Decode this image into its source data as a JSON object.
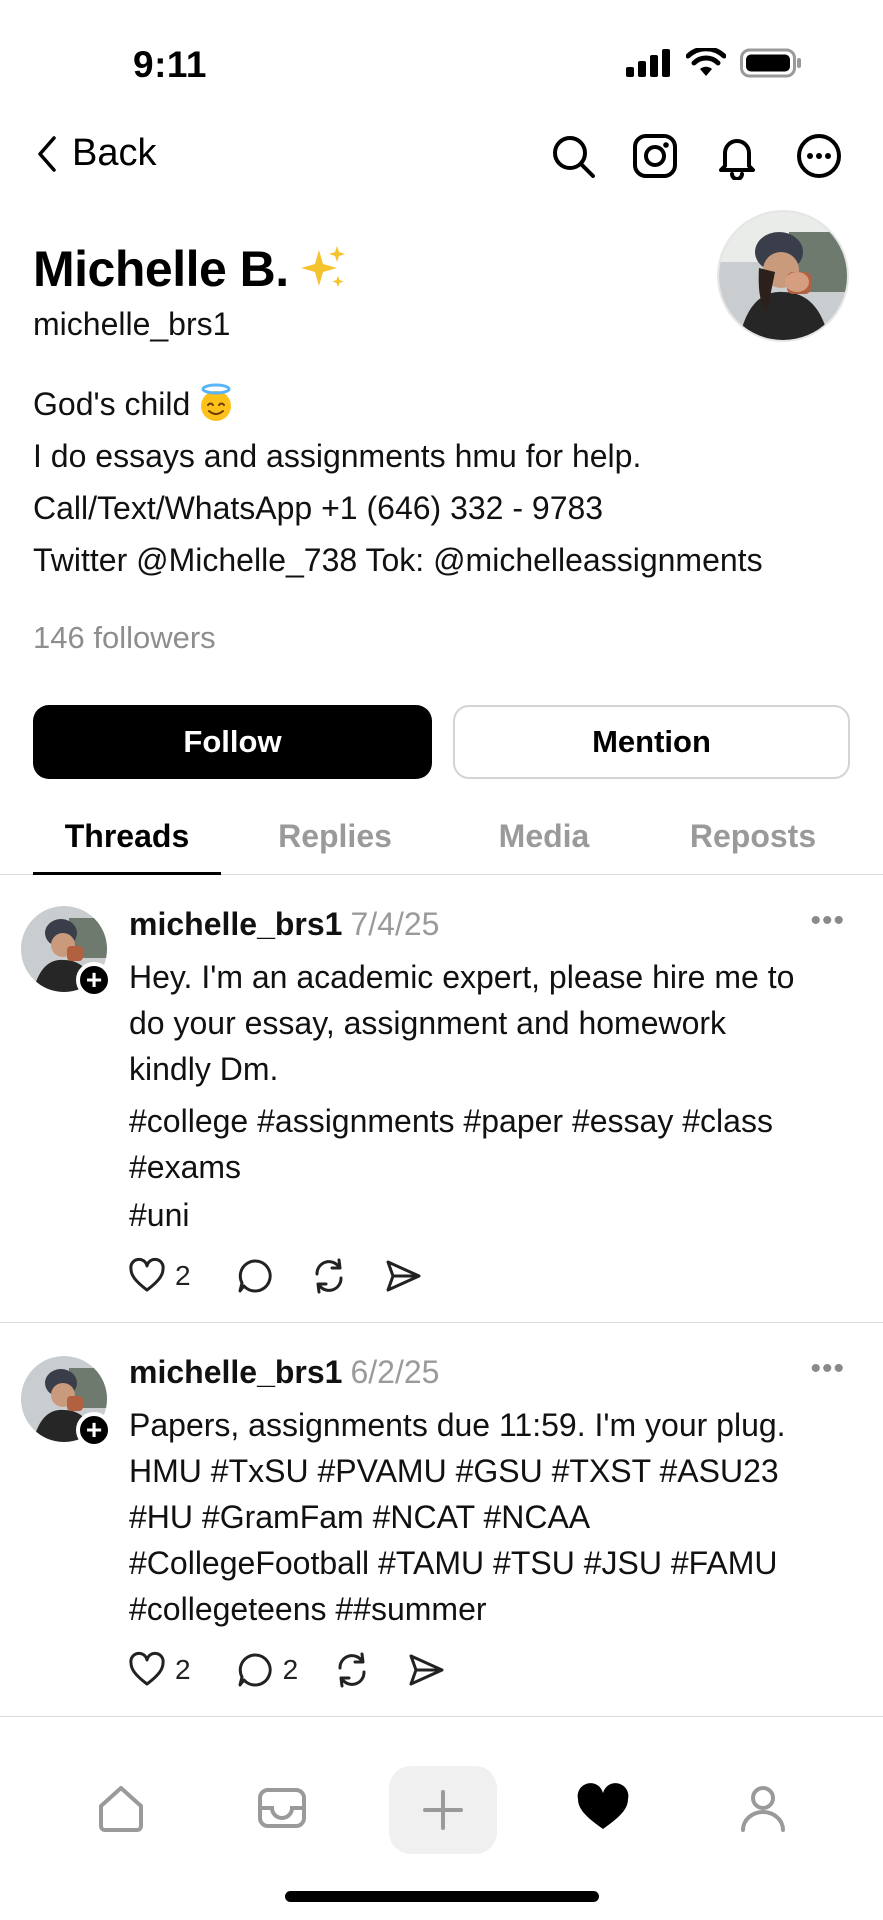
{
  "status_bar": {
    "time": "9:11"
  },
  "nav": {
    "back_label": "Back",
    "icons": [
      "search-icon",
      "instagram-icon",
      "bell-icon",
      "more-icon"
    ]
  },
  "profile": {
    "name": "Michelle B.",
    "name_emoji": "sparkles",
    "handle": "michelle_brs1",
    "bio_lines": [
      "God's child",
      "I do essays and assignments hmu for help.",
      "Call/Text/WhatsApp +1 (646) 332 - 9783",
      "Twitter @Michelle_738 Tok: @michelleassignments"
    ],
    "followers": "146 followers",
    "follow_label": "Follow",
    "mention_label": "Mention"
  },
  "tabs": [
    {
      "label": "Threads",
      "active": true
    },
    {
      "label": "Replies",
      "active": false
    },
    {
      "label": "Media",
      "active": false
    },
    {
      "label": "Reposts",
      "active": false
    }
  ],
  "posts": [
    {
      "user": "michelle_brs1",
      "date": "7/4/25",
      "lines": [
        "Hey. I'm an academic expert, please hire me to",
        "do your essay, assignment and homework",
        "kindly Dm.",
        "#college #assignments #paper #essay #class",
        "#exams",
        "#uni"
      ],
      "likes": "2",
      "replies": ""
    },
    {
      "user": "michelle_brs1",
      "date": "6/2/25",
      "lines": [
        "Papers, assignments due 11:59. I'm your plug.",
        "HMU  #TxSU #PVAMU #GSU #TXST #ASU23",
        "#HU #GramFam #NCAT #NCAA",
        "#CollegeFootball #TAMU #TSU #JSU #FAMU",
        "#collegeteens ##summer"
      ],
      "likes": "2",
      "replies": "2"
    }
  ],
  "bottom_nav": [
    "home-icon",
    "inbox-icon",
    "compose-icon",
    "activity-heart-icon",
    "profile-icon"
  ],
  "colors": {
    "accent": "#000000",
    "muted": "#9a9a9a",
    "border": "#d4d4d4"
  }
}
